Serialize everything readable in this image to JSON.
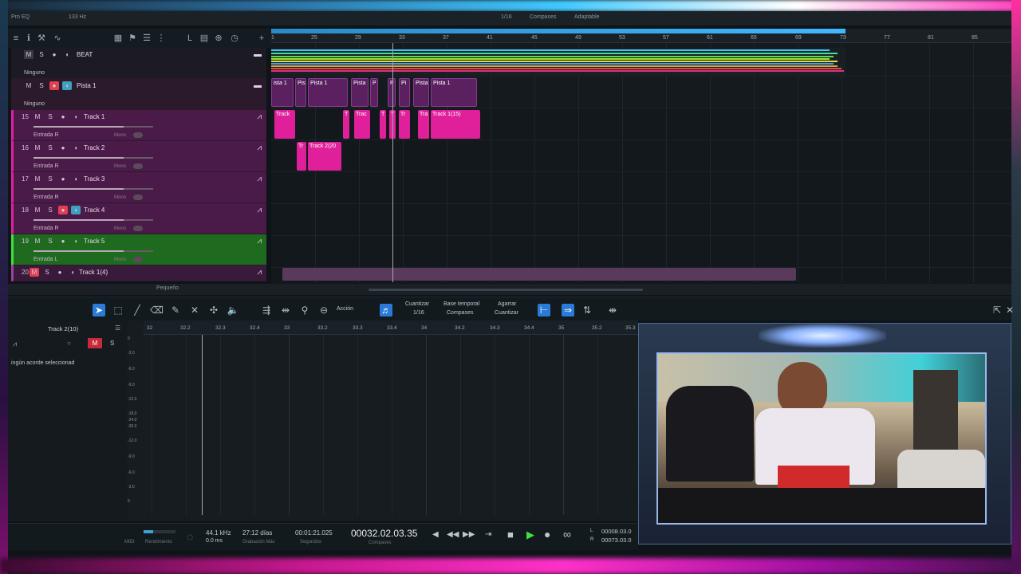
{
  "topbar": {
    "left_label": "Pro EQ",
    "rate": "133 Hz",
    "grid": "1/16",
    "timebase": "Compases",
    "snap": "Adaptable"
  },
  "arrange_ruler": {
    "ticks": [
      "25",
      "29",
      "33",
      "37",
      "41",
      "45",
      "49",
      "53",
      "57",
      "61",
      "65",
      "69",
      "73",
      "77",
      "81",
      "85"
    ],
    "start_marker": "1"
  },
  "tracks": [
    {
      "kind": "folder",
      "name": "BEAT",
      "mute": "M",
      "solo": "S",
      "dropdown": "Ninguno"
    },
    {
      "kind": "folder",
      "name": "Pista 1",
      "mute": "M",
      "solo": "S",
      "dropdown": "Ninguno"
    },
    {
      "kind": "audio",
      "num": "15",
      "name": "Track 1",
      "mute": "M",
      "solo": "S",
      "input": "Entrada R",
      "mono": "Mono"
    },
    {
      "kind": "audio",
      "num": "16",
      "name": "Track 2",
      "mute": "M",
      "solo": "S",
      "input": "Entrada R",
      "mono": "Mono"
    },
    {
      "kind": "audio",
      "num": "17",
      "name": "Track 3",
      "mute": "M",
      "solo": "S",
      "input": "Entrada R",
      "mono": "Mono"
    },
    {
      "kind": "audio",
      "num": "18",
      "name": "Track 4",
      "mute": "M",
      "solo": "S",
      "input": "Entrada R",
      "mono": "Mono"
    },
    {
      "kind": "audio",
      "num": "19",
      "name": "Track 5",
      "mute": "M",
      "solo": "S",
      "input": "Entrada L",
      "mono": "Mono"
    },
    {
      "kind": "audio",
      "num": "20",
      "name": "Track 1(4)",
      "mute": "M",
      "solo": "S"
    }
  ],
  "clips": {
    "pista": [
      "ista 1",
      "Pis",
      "Pista 1",
      "Pista",
      "P",
      "P",
      "Pi",
      "Pista",
      "Pista 1"
    ],
    "track1": [
      "Track",
      "T",
      "Trac",
      "T",
      "T",
      "Tr",
      "Tra",
      "Track 1(15)"
    ],
    "track2": [
      "Tr",
      "Track 2(20"
    ]
  },
  "footer_size": "Pequeño",
  "edit_toolbar": {
    "action_label": "Acción",
    "quantize_label": "Cuantizar",
    "quantize_value": "1/16",
    "timebase_label": "Base temporal",
    "timebase_value": "Compases",
    "snap_label": "Agarrar",
    "snap_value": "Cuantizar"
  },
  "editor": {
    "track_name": "Track 2(10)",
    "chord_text": "ingún acorde seleccionad",
    "ruler": [
      "32",
      "32.2",
      "32.3",
      "32.4",
      "33",
      "33.2",
      "33.3",
      "33.4",
      "34",
      "34.2",
      "34.3",
      "34.4",
      "35",
      "35.2",
      "35.3"
    ],
    "scale": [
      "0",
      "-3.0",
      "-6.0",
      "-9.0",
      "-12.0",
      "-18.0",
      "-24.0",
      "-30.0",
      "-12.0",
      "-9.0",
      "-6.0",
      "-3.0",
      "0"
    ]
  },
  "transport": {
    "midi": "MIDI",
    "performance": "Rendimiento",
    "sample_rate": "44.1 kHz",
    "latency": "0.0 ms",
    "record_days": "27:12 días",
    "record_max": "Grabación Máx",
    "seconds_time": "00:01:21.025",
    "seconds_label": "Segundos",
    "position": "00032.02.03.35",
    "position_unit": "Compases",
    "loop_l": "00008.03.0",
    "loop_r": "00073.03.0",
    "l_label": "L",
    "r_label": "R"
  },
  "colors": {
    "accent": "#2a7ad8",
    "clip_pink": "#e0209a",
    "track_purple": "#4a1a48",
    "track_green": "#1e6a1e"
  }
}
